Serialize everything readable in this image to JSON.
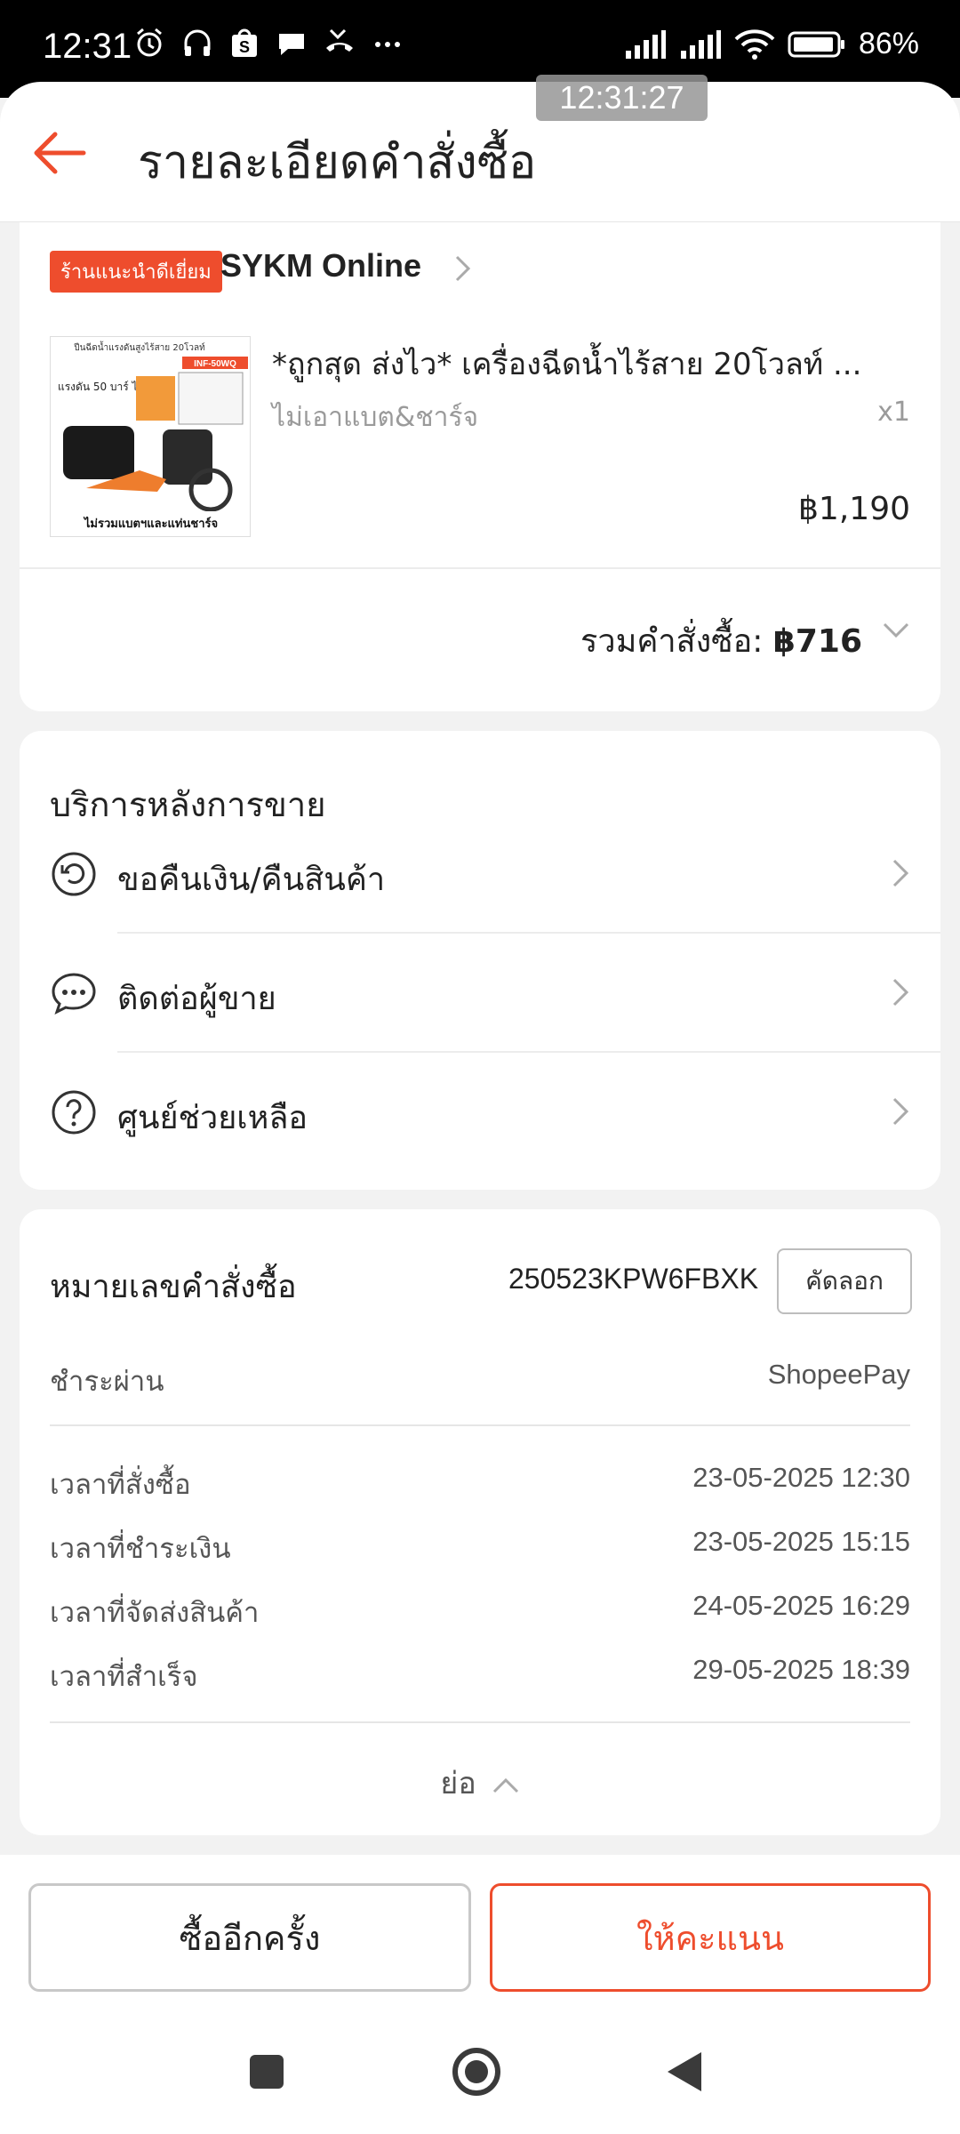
{
  "status_bar": {
    "time": "12:31",
    "battery": "86%"
  },
  "screen_overlay_time": "12:31:27",
  "header": {
    "title": "รายละเอียดคำสั่งซื้อ",
    "back_icon": "arrow-left-icon"
  },
  "colors": {
    "accent": "#ee4d2d"
  },
  "shop": {
    "badge": "ร้านแนะนำดีเยี่ยม",
    "name": "SYKM Online"
  },
  "product": {
    "title": "*ถูกสุด ส่งไว* เครื่องฉีดน้ำไร้สาย 20โวลท์ ...",
    "variant": "ไม่เอาแบต&ชาร์จ",
    "quantity": "x1",
    "price": "฿1,190",
    "thumb_text": {
      "top": "ปืนฉีดน้ำแรงดันสูงไร้สาย 20โวลท์",
      "model": "INF-50WQ",
      "left": "แรงดัน 50 บาร์ ไร้สาย",
      "bottom": "ไม่รวมแบตฯและแท่นชาร์จ"
    }
  },
  "order_total": {
    "label": "รวมคำสั่งซื้อ:",
    "value": "฿716"
  },
  "after_sales": {
    "heading": "บริการหลังการขาย",
    "items": [
      {
        "label": "ขอคืนเงิน/คืนสินค้า",
        "icon": "return-icon"
      },
      {
        "label": "ติดต่อผู้ขาย",
        "icon": "chat-icon"
      },
      {
        "label": "ศูนย์ช่วยเหลือ",
        "icon": "help-icon"
      }
    ]
  },
  "order_info": {
    "order_no_label": "หมายเลขคำสั่งซื้อ",
    "order_no": "250523KPW6FBXK",
    "copy_label": "คัดลอก",
    "payment_label": "ชำระผ่าน",
    "payment_value": "ShopeePay",
    "times": [
      {
        "label": "เวลาที่สั่งซื้อ",
        "value": "23-05-2025 12:30"
      },
      {
        "label": "เวลาที่ชำระเงิน",
        "value": "23-05-2025 15:15"
      },
      {
        "label": "เวลาที่จัดส่งสินค้า",
        "value": "24-05-2025 16:29"
      },
      {
        "label": "เวลาที่สำเร็จ",
        "value": "29-05-2025 18:39"
      }
    ],
    "collapse_label": "ย่อ"
  },
  "actions": {
    "buy_again": "ซื้ออีกครั้ง",
    "rate": "ให้คะแนน"
  }
}
